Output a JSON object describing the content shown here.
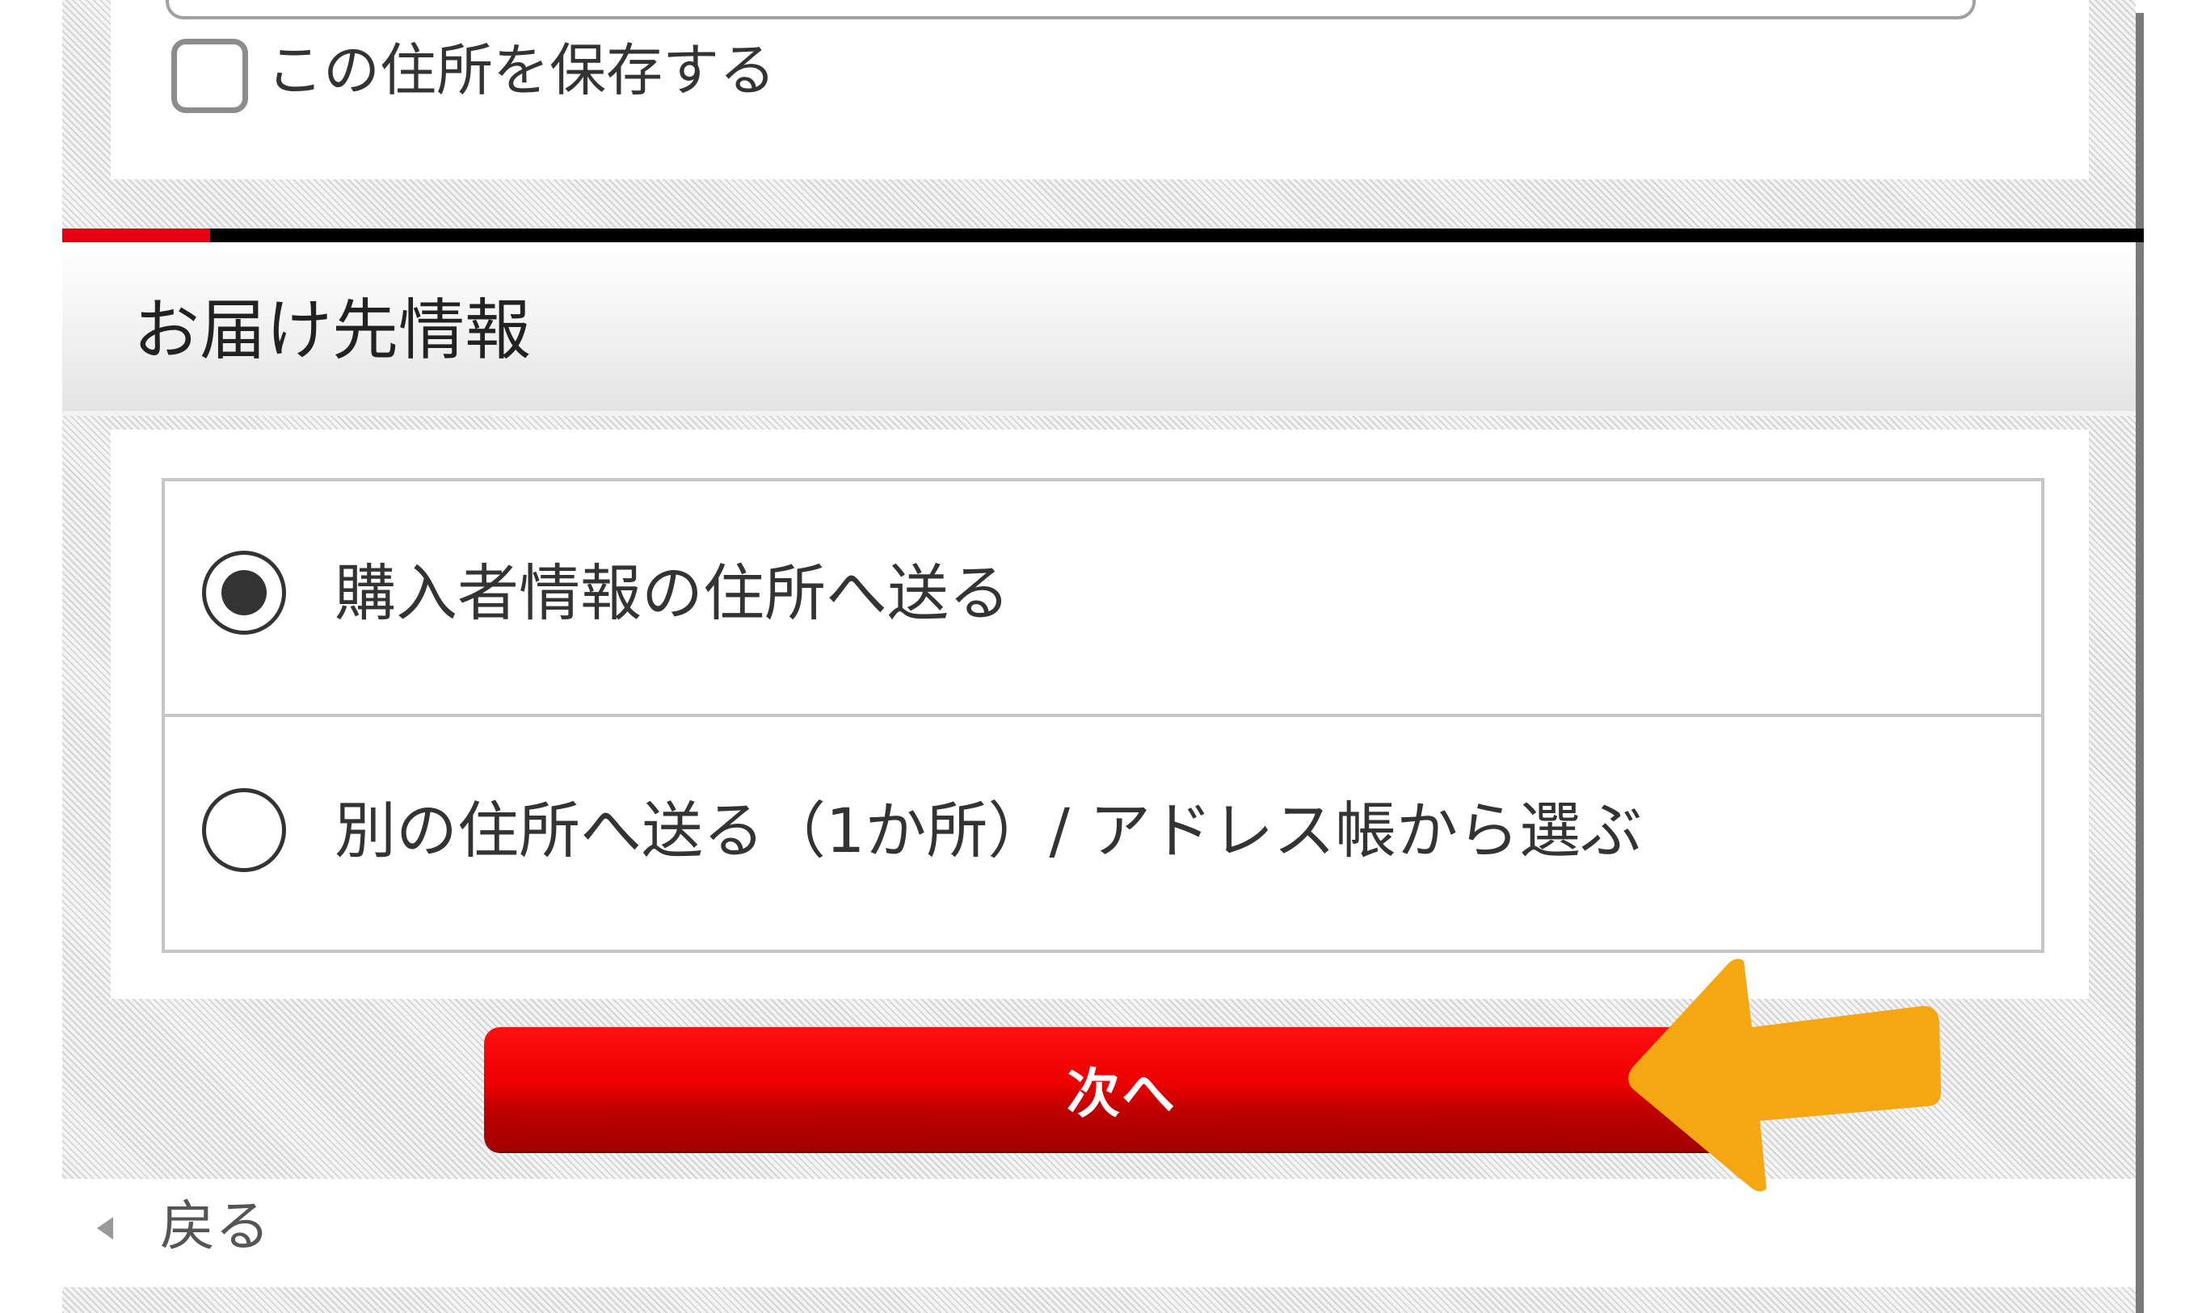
{
  "save_address": {
    "checked": false,
    "label": "この住所を保存する"
  },
  "section": {
    "title": "お届け先情報",
    "accent_color": "#e60012",
    "rule_color": "#000000"
  },
  "delivery_options": [
    {
      "label": "購入者情報の住所へ送る",
      "selected": true
    },
    {
      "label": "別の住所へ送る（1か所）/ アドレス帳から選ぶ",
      "selected": false
    }
  ],
  "next_button": {
    "label": "次へ",
    "color": "#e60000"
  },
  "back_link": {
    "label": "戻る",
    "icon": "triangle-left-icon"
  },
  "annotation": {
    "icon": "arrow-left-icon",
    "color": "#f5a711"
  }
}
